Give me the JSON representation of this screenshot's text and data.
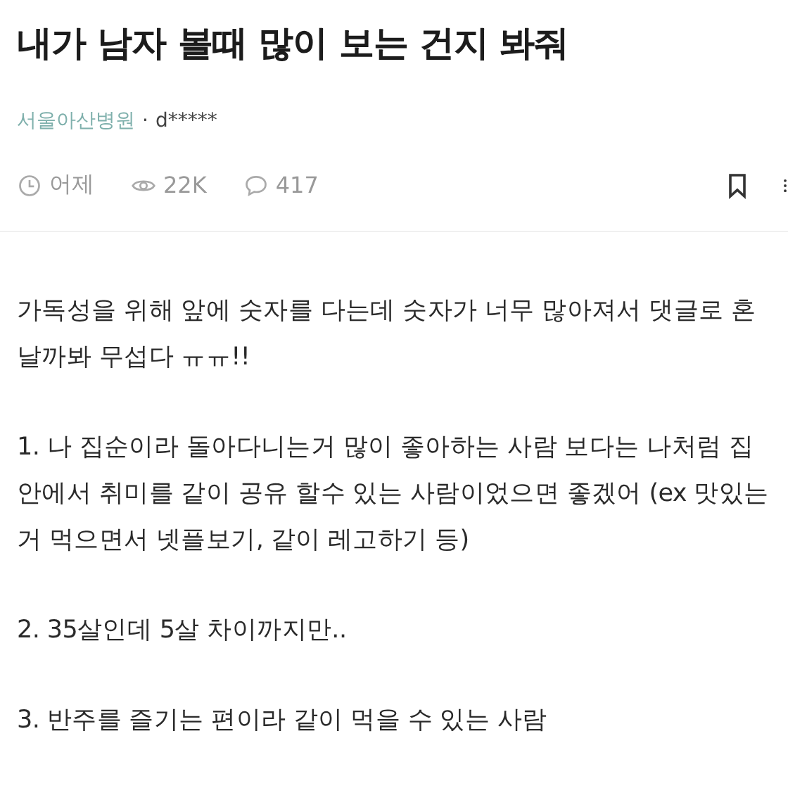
{
  "post": {
    "title": "내가 남자 볼때 많이 보는 건지 봐줘",
    "company": "서울아산병원",
    "separator": "·",
    "author": "d*****",
    "time": "어제",
    "views": "22K",
    "comments": "417",
    "paragraphs": [
      "가독성을 위해 앞에 숫자를 다는데 숫자가 너무 많아져서 댓글로 혼날까봐 무섭다 ㅠㅠ!!",
      "1. 나 집순이라 돌아다니는거 많이 좋아하는 사람 보다는 나처럼 집안에서 취미를 같이 공유 할수 있는 사람이었으면 좋겠어 (ex 맛있는거 먹으면서 넷플보기, 같이 레고하기 등)",
      "2. 35살인데 5살 차이까지만..",
      "3. 반주를 즐기는 편이라 같이 먹을 수 있는 사람"
    ]
  }
}
